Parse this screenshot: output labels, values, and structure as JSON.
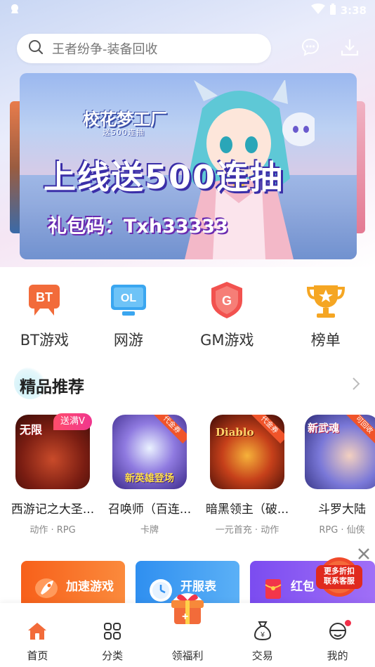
{
  "status_bar": {
    "time": "3:38"
  },
  "search": {
    "placeholder": "王者纷争-装备回收"
  },
  "banner": {
    "logo": "校花梦工厂",
    "logo_sub": "送500连抽",
    "headline": "上线送500连抽",
    "gift_code": "礼包码：Txh33333"
  },
  "categories": [
    {
      "label": "BT游戏",
      "icon": "bt-icon",
      "color": "#f26b3a"
    },
    {
      "label": "网游",
      "icon": "ol-monitor-icon",
      "color": "#3aa6f0"
    },
    {
      "label": "GM游戏",
      "icon": "gm-shield-icon",
      "color": "#f2524f"
    },
    {
      "label": "榜单",
      "icon": "trophy-icon",
      "color": "#f5a623"
    }
  ],
  "section": {
    "title": "精品推荐"
  },
  "games": [
    {
      "name": "西游记之大圣...",
      "tags": "动作 · RPG",
      "badge": "送满V",
      "img_label": "无限"
    },
    {
      "name": "召唤师（百连...",
      "tags": "卡牌",
      "corner": "代金券",
      "img_label": "新英雄登场"
    },
    {
      "name": "暗黑领主（破...",
      "tags": "一元首充 · 动作",
      "corner": "代金券",
      "img_label": "Diablo"
    },
    {
      "name": "斗罗大陆",
      "tags": "RPG · 仙侠",
      "corner": "可回收",
      "img_label": "新武魂"
    }
  ],
  "quick_cards": [
    {
      "label": "加速游戏",
      "color": "#f76b1c"
    },
    {
      "label": "开服表",
      "color": "#3d9cf0"
    },
    {
      "label": "红包",
      "color": "#8b5cf0"
    }
  ],
  "float_service": {
    "line1": "更多折扣",
    "line2": "联系客服"
  },
  "bottom_nav": [
    {
      "label": "首页",
      "icon": "home-icon",
      "active": true
    },
    {
      "label": "分类",
      "icon": "grid-icon"
    },
    {
      "label": "领福利",
      "icon": "gift-icon"
    },
    {
      "label": "交易",
      "icon": "money-bag-icon"
    },
    {
      "label": "我的",
      "icon": "profile-icon"
    }
  ]
}
